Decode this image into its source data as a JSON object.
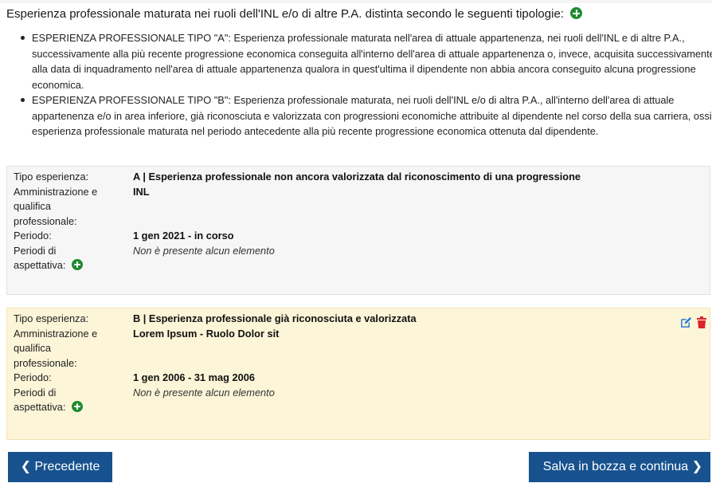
{
  "intro": {
    "text": "Esperienza professionale maturata nei ruoli dell'INL e/o di altre P.A. distinta secondo le seguenti tipologie:"
  },
  "types": [
    "ESPERIENZA PROFESSIONALE TIPO \"A\": Esperienza professionale maturata nell'area di attuale appartenenza, nei ruoli dell'INL e di altre P.A., successivamente alla più recente progressione economica conseguita all'interno dell'area di attuale appartenenza o, invece, acquisita successivamente alla data di inquadramento nell'area di attuale appartenenza qualora in quest'ultima il dipendente non abbia ancora conseguito alcuna progressione economica.",
    "ESPERIENZA PROFESSIONALE TIPO \"B\": Esperienza professionale maturata, nei ruoli dell'INL e/o di altra P.A., all'interno dell'area di attuale appartenenza e/o in area inferiore, già riconosciuta e valorizzata con progressioni economiche attribuite al dipendente nel corso della sua carriera, ossia esperienza professionale maturata nel periodo antecedente alla più recente progressione economica ottenuta dal dipendente."
  ],
  "labels": {
    "tipo": "Tipo esperienza:",
    "amm1": "Amministrazione e",
    "amm2": "qualifica",
    "amm3": "professionale:",
    "periodo": "Periodo:",
    "asp1": "Periodi di",
    "asp2": "aspettativa:"
  },
  "entries": [
    {
      "tipo": "A | Esperienza professionale non ancora valorizzata dal riconoscimento di una progressione",
      "amministrazione": "INL",
      "periodo": "1 gen 2021 - in corso",
      "aspettativa": "Non è presente alcun elemento"
    },
    {
      "tipo": "B | Esperienza professionale già riconosciuta e valorizzata",
      "amministrazione": "Lorem Ipsum - Ruolo Dolor sit",
      "periodo": "1 gen 2006 - 31 mag 2006",
      "aspettativa": "Non è presente alcun elemento"
    }
  ],
  "buttons": {
    "prev": "Precedente",
    "next": "Salva in bozza e continua"
  },
  "icons": {
    "add": "plus-circle-icon",
    "edit": "edit-icon",
    "delete": "trash-icon",
    "prev": "chevron-left-icon",
    "next": "chevron-right-icon"
  },
  "colors": {
    "primary": "#17528f",
    "add": "#1f8a31",
    "delete": "#d9232e",
    "edit": "#2b7fd6",
    "highlight_card": "#fdf5d8"
  }
}
